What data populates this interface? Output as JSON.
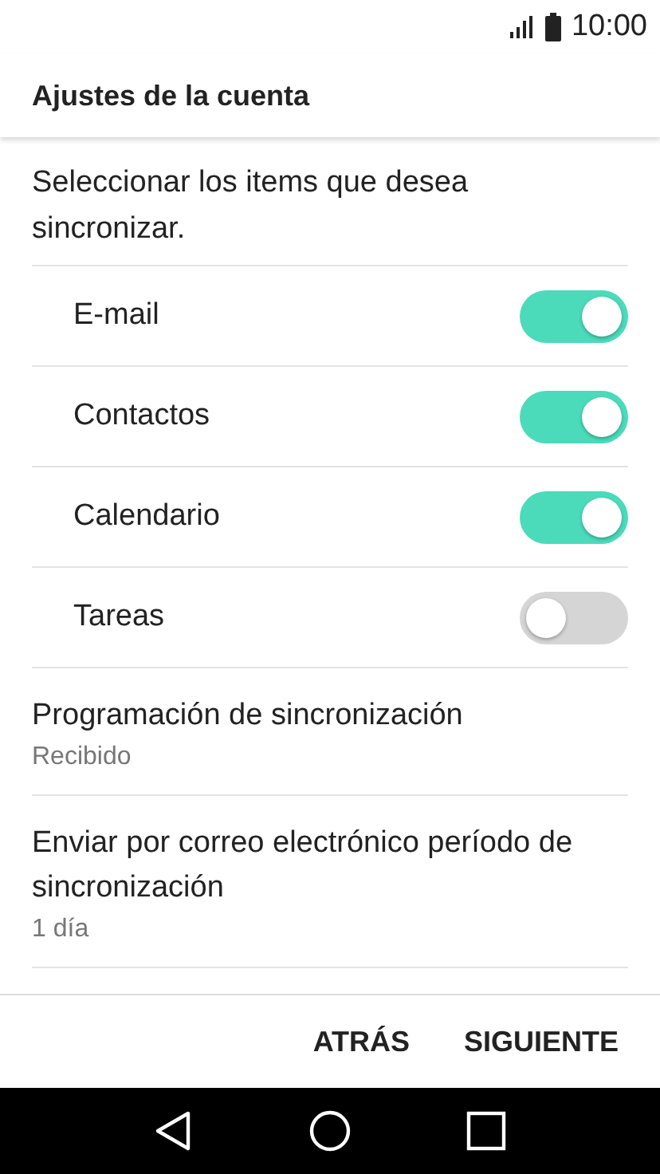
{
  "status_bar": {
    "time": "10:00"
  },
  "header": {
    "title": "Ajustes de la cuenta"
  },
  "description": "Seleccionar los items que desea sincronizar.",
  "sync_items": [
    {
      "label": "E-mail",
      "on": true
    },
    {
      "label": "Contactos",
      "on": true
    },
    {
      "label": "Calendario",
      "on": true
    },
    {
      "label": "Tareas",
      "on": false
    }
  ],
  "settings": [
    {
      "title": "Programación de sincronización",
      "value": "Recibido"
    },
    {
      "title": "Enviar por correo electrónico período de sincronización",
      "value": "1 día"
    }
  ],
  "buttons": [
    "ATRÁS",
    "SIGUIENTE"
  ]
}
